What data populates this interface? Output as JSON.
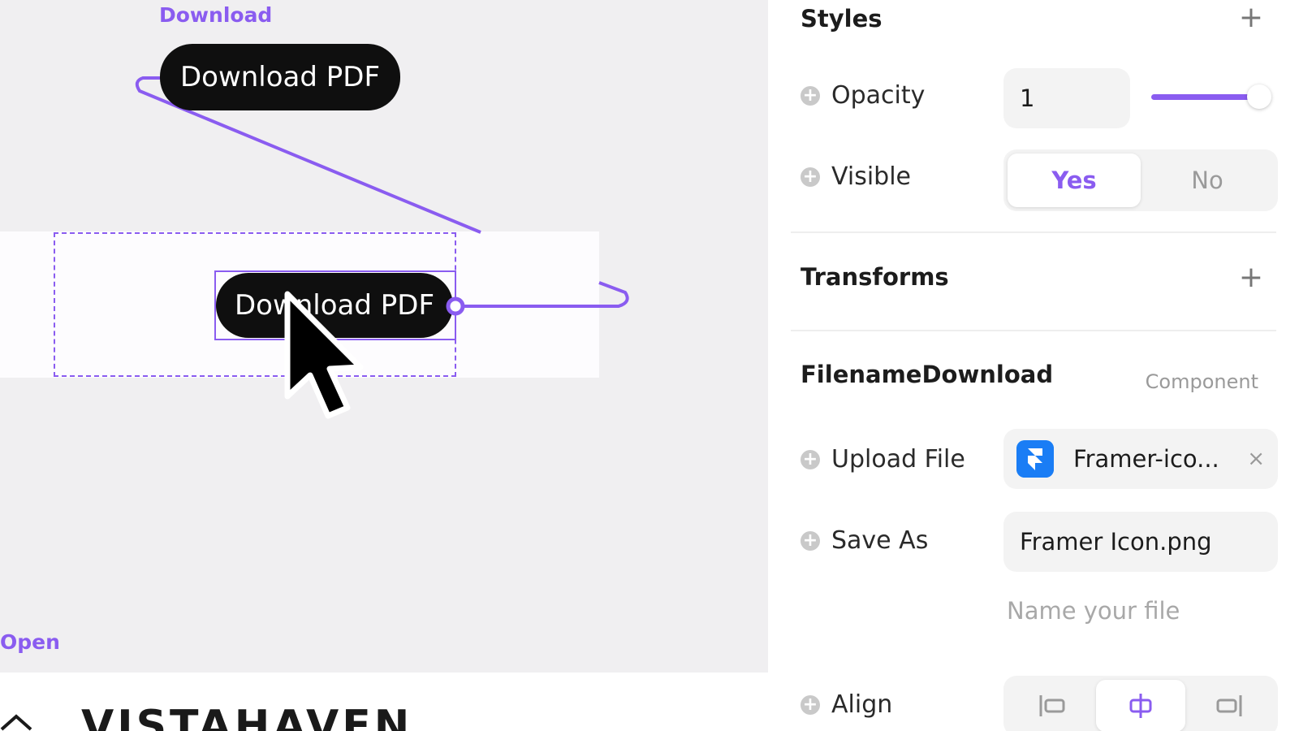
{
  "canvas": {
    "frame_download_label": "Download",
    "frame_open_label": "Open",
    "button_top_label": "Download PDF",
    "button_main_label": "Download PDF",
    "logo_text": "VISTAHAVEN",
    "accent_color": "#8a5cf0"
  },
  "panel": {
    "styles": {
      "title": "Styles",
      "add": "+",
      "opacity_label": "Opacity",
      "opacity_value": "1",
      "opacity_fraction": 1,
      "visible_label": "Visible",
      "visible_options": [
        "Yes",
        "No"
      ],
      "visible_selected": "Yes"
    },
    "transforms": {
      "title": "Transforms",
      "add": "+"
    },
    "component": {
      "title": "FilenameDownload",
      "tag": "Component",
      "upload_label": "Upload File",
      "upload_value": "Framer-ico...",
      "upload_icon": "framer-icon",
      "upload_clear": "×",
      "save_as_label": "Save As",
      "save_as_value": "Framer Icon.png",
      "save_as_hint": "Name your file",
      "align_label": "Align",
      "align_options": [
        "align-left-icon",
        "align-center-icon",
        "align-right-icon"
      ],
      "align_selected": "align-center-icon"
    }
  }
}
